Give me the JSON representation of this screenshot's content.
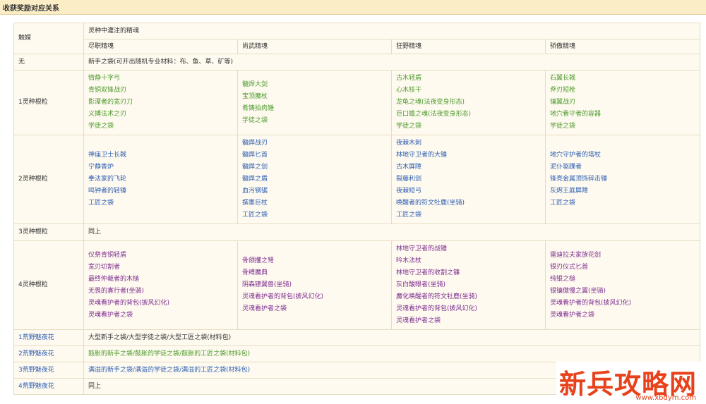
{
  "page_title": "收获奖励对应关系",
  "header": {
    "trigger": "触媒",
    "group": "灵种中灌注的精魂",
    "cols": [
      "尽职精魂",
      "尚武精魂",
      "狂野精魂",
      "骄傲精魂"
    ]
  },
  "rows": [
    {
      "label": "无",
      "span": "新手之袋(可开出随机专业材料：布、鱼、草、矿等)",
      "color": "dark"
    },
    {
      "label": "1灵种根粒",
      "color": "green",
      "cols": [
        [
          "情静十字弓",
          "青铜双锋战刃",
          "影潭者的宽刃刀",
          "义搏法术之刃",
          "学徒之袋"
        ],
        [
          "髓焊大剑",
          "宝顶魔杖",
          "肴铸拍肉锤",
          "学徒之袋"
        ],
        [
          "古木轻盾",
          "心木枝干",
          "龙龟之魂(法夜变身形态)",
          "巨口蟾之魂(法夜变身形态)",
          "学徒之袋"
        ],
        [
          "石翼长戟",
          "斧刃短枪",
          "镶翼战刃",
          "地穴看守者的容器",
          "学徒之袋"
        ]
      ]
    },
    {
      "label": "2灵种根粒",
      "color": "blue",
      "cols": [
        [
          "神庙卫士长戟",
          "宁静香炉",
          "拳法家的飞轮",
          "鸣钟者的轻锤",
          "工匠之袋"
        ],
        [
          "髓焊战刃",
          "髓焊匕首",
          "髓焊之剑",
          "髓焊之盾",
          "血污钢锯",
          "撰墨巨杖",
          "工匠之袋"
        ],
        [
          "夜棘木刺",
          "林地守卫者的大锤",
          "古木屏障",
          "裂藤利剑",
          "夜棘短弓",
          "唤醒者的符文牡鹿(坐骑)",
          "工匠之袋"
        ],
        [
          "地穴守护者的塔杖",
          "泥仆驱踝者",
          "锋亮金属顶饰碎击锤",
          "灰烬王庭屏障",
          "工匠之袋"
        ]
      ]
    },
    {
      "label": "3灵种根粒",
      "span": "同上",
      "color": "dark"
    },
    {
      "label": "4灵种根粒",
      "color": "purple",
      "cols": [
        [
          "仪祭青铜轻盾",
          "宽刃切割者",
          "最终仲裁者的木槌",
          "无畏的寡行者(坐骑)",
          "灵魂看护者的背包(披风幻化)",
          "灵魂看护者之袋"
        ],
        [
          "骨颌攫之弩",
          "骨缚魔典",
          "阴森镣翼兽(坐骑)",
          "灵魂看护者的背包(披风幻化)",
          "灵魂看护者之袋"
        ],
        [
          "林地守卫者的战锤",
          "吟木法杖",
          "林地守卫者的收割之镰",
          "灰白酸眼者(坐骑)",
          "魔化唤醒者的符文牡鹿(坐骑)",
          "灵魂看护者的背包(披风幻化)",
          "灵魂看护者之袋"
        ],
        [
          "雷迪拉夫家族花剑",
          "银刃仪式匕首",
          "纯银之槌",
          "银镶傲慢之翼(坐骑)",
          "灵魂看护者的背包(披风幻化)",
          "灵魂看护者之袋"
        ]
      ]
    },
    {
      "label": "1荒野魅夜花",
      "span": "大型新手之袋/大型学徒之袋/大型工匠之袋(材料包)",
      "color": "dark",
      "label_color": "blue"
    },
    {
      "label": "2荒野魅夜花",
      "span": "鼓胀的新手之袋/鼓胀的学徒之袋/鼓胀的工匠之袋(材料包)",
      "color": "green",
      "label_color": "blue"
    },
    {
      "label": "3荒野魅夜花",
      "span": "满溢的新手之袋/满溢的学徒之袋/满溢的工匠之袋(材料包)",
      "color": "blue",
      "label_color": "blue"
    },
    {
      "label": "4荒野魅夜花",
      "span": "同上",
      "color": "dark",
      "label_color": "blue"
    }
  ],
  "watermark": {
    "logo_text": "新兵攻略网",
    "url": "www.xbdym.com"
  }
}
